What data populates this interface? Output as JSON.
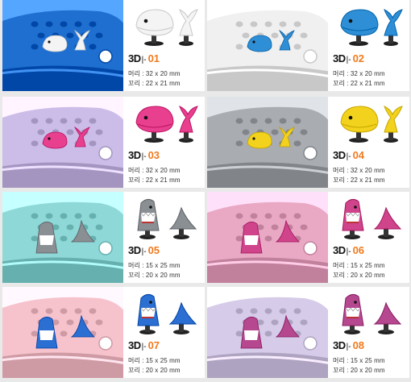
{
  "products": [
    {
      "code_prefix": "3D",
      "code_number": "01",
      "head_label": "머리 : 32 x 20 mm",
      "tail_label": "꼬리 : 22 x 21 mm",
      "shoe_color": "#1e6fd0",
      "charm_color": "#f4f4f4",
      "icon": "whale-icon"
    },
    {
      "code_prefix": "3D",
      "code_number": "02",
      "head_label": "머리 : 32 x 20 mm",
      "tail_label": "꼬리 : 22 x 21 mm",
      "shoe_color": "#f0f0f0",
      "charm_color": "#2f8fd6",
      "icon": "whale-icon"
    },
    {
      "code_prefix": "3D",
      "code_number": "03",
      "head_label": "머리 : 32 x 20 mm",
      "tail_label": "꼬리 : 22 x 21 mm",
      "shoe_color": "#cbbde8",
      "charm_color": "#e8408f",
      "icon": "whale-icon"
    },
    {
      "code_prefix": "3D",
      "code_number": "04",
      "head_label": "머리 : 32 x 20 mm",
      "tail_label": "꼬리 : 22 x 21 mm",
      "shoe_color": "#a9adb2",
      "charm_color": "#f2d21c",
      "icon": "whale-icon"
    },
    {
      "code_prefix": "3D",
      "code_number": "05",
      "head_label": "머리 : 15 x 25 mm",
      "tail_label": "꼬리 : 20 x 20 mm",
      "shoe_color": "#8fd8d8",
      "charm_color": "#8a8f94",
      "icon": "shark-icon"
    },
    {
      "code_prefix": "3D",
      "code_number": "06",
      "head_label": "머리 : 15 x 25 mm",
      "tail_label": "꼬리 : 20 x 20 mm",
      "shoe_color": "#e9a9c4",
      "charm_color": "#d0448c",
      "icon": "shark-icon"
    },
    {
      "code_prefix": "3D",
      "code_number": "07",
      "head_label": "머리 : 15 x 25 mm",
      "tail_label": "꼬리 : 20 x 20 mm",
      "shoe_color": "#f6c2cc",
      "charm_color": "#2c6fd2",
      "icon": "shark-icon"
    },
    {
      "code_prefix": "3D",
      "code_number": "08",
      "head_label": "머리 : 15 x 25 mm",
      "tail_label": "꼬리 : 20 x 20 mm",
      "shoe_color": "#d6cbe8",
      "charm_color": "#b5488f",
      "icon": "shark-icon"
    }
  ]
}
